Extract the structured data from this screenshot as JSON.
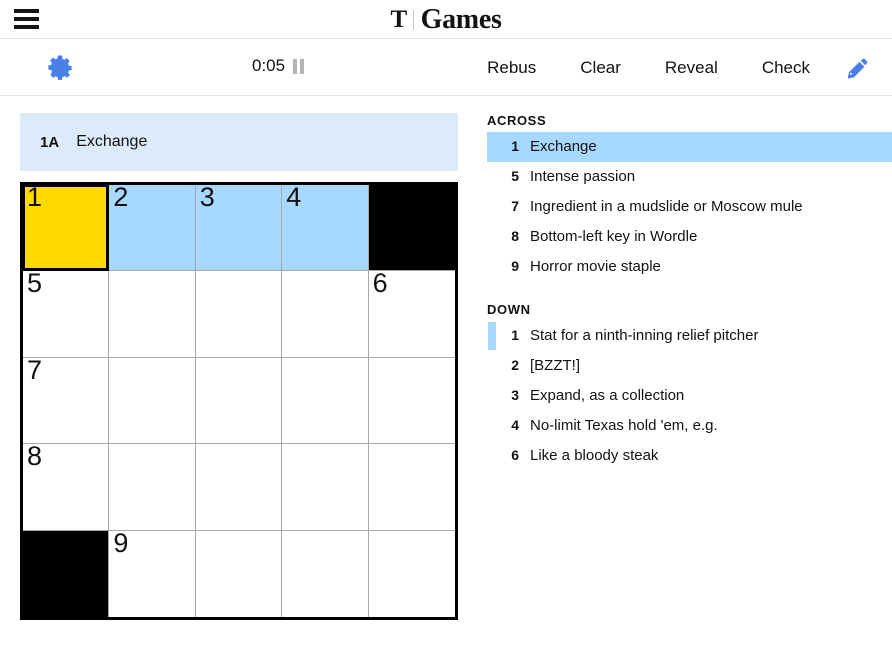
{
  "masthead": {
    "menu_icon": "hamburger-icon",
    "logo_t": "T",
    "logo_word": "Games"
  },
  "toolbar": {
    "settings_icon": "gear-icon",
    "timer": "0:05",
    "pause_icon": "pause-icon",
    "rebus_label": "Rebus",
    "clear_label": "Clear",
    "reveal_label": "Reveal",
    "check_label": "Check",
    "pencil_icon": "pencil-icon",
    "accent_blue": "#4A7FE8"
  },
  "current_clue": {
    "number": "1A",
    "text": "Exchange"
  },
  "colors": {
    "selected_cell": "#FFDA00",
    "highlight_cell": "#A7D8FF",
    "clue_bar_bg": "#DCEBFA",
    "block_cell": "#000000"
  },
  "grid": {
    "rows": 5,
    "cols": 5,
    "cells": [
      {
        "num": "1",
        "state": "selected",
        "letter": ""
      },
      {
        "num": "2",
        "state": "highlight",
        "letter": ""
      },
      {
        "num": "3",
        "state": "highlight",
        "letter": ""
      },
      {
        "num": "4",
        "state": "highlight",
        "letter": ""
      },
      {
        "num": "",
        "state": "block",
        "letter": ""
      },
      {
        "num": "5",
        "state": "empty",
        "letter": ""
      },
      {
        "num": "",
        "state": "empty",
        "letter": ""
      },
      {
        "num": "",
        "state": "empty",
        "letter": ""
      },
      {
        "num": "",
        "state": "empty",
        "letter": ""
      },
      {
        "num": "6",
        "state": "empty",
        "letter": ""
      },
      {
        "num": "7",
        "state": "empty",
        "letter": ""
      },
      {
        "num": "",
        "state": "empty",
        "letter": ""
      },
      {
        "num": "",
        "state": "empty",
        "letter": ""
      },
      {
        "num": "",
        "state": "empty",
        "letter": ""
      },
      {
        "num": "",
        "state": "empty",
        "letter": ""
      },
      {
        "num": "8",
        "state": "empty",
        "letter": ""
      },
      {
        "num": "",
        "state": "empty",
        "letter": ""
      },
      {
        "num": "",
        "state": "empty",
        "letter": ""
      },
      {
        "num": "",
        "state": "empty",
        "letter": ""
      },
      {
        "num": "",
        "state": "empty",
        "letter": ""
      },
      {
        "num": "",
        "state": "block",
        "letter": ""
      },
      {
        "num": "9",
        "state": "empty",
        "letter": ""
      },
      {
        "num": "",
        "state": "empty",
        "letter": ""
      },
      {
        "num": "",
        "state": "empty",
        "letter": ""
      },
      {
        "num": "",
        "state": "empty",
        "letter": ""
      }
    ]
  },
  "across": {
    "title": "ACROSS",
    "clues": [
      {
        "num": "1",
        "text": "Exchange",
        "active": true
      },
      {
        "num": "5",
        "text": "Intense passion",
        "active": false
      },
      {
        "num": "7",
        "text": "Ingredient in a mudslide or Moscow mule",
        "active": false
      },
      {
        "num": "8",
        "text": "Bottom-left key in Wordle",
        "active": false
      },
      {
        "num": "9",
        "text": "Horror movie staple",
        "active": false
      }
    ]
  },
  "down": {
    "title": "DOWN",
    "clues": [
      {
        "num": "1",
        "text": "Stat for a ninth-inning relief pitcher",
        "active": true
      },
      {
        "num": "2",
        "text": "[BZZT!]",
        "active": false
      },
      {
        "num": "3",
        "text": "Expand, as a collection",
        "active": false
      },
      {
        "num": "4",
        "text": "No-limit Texas hold 'em, e.g.",
        "active": false
      },
      {
        "num": "6",
        "text": "Like a bloody steak",
        "active": false
      }
    ]
  }
}
